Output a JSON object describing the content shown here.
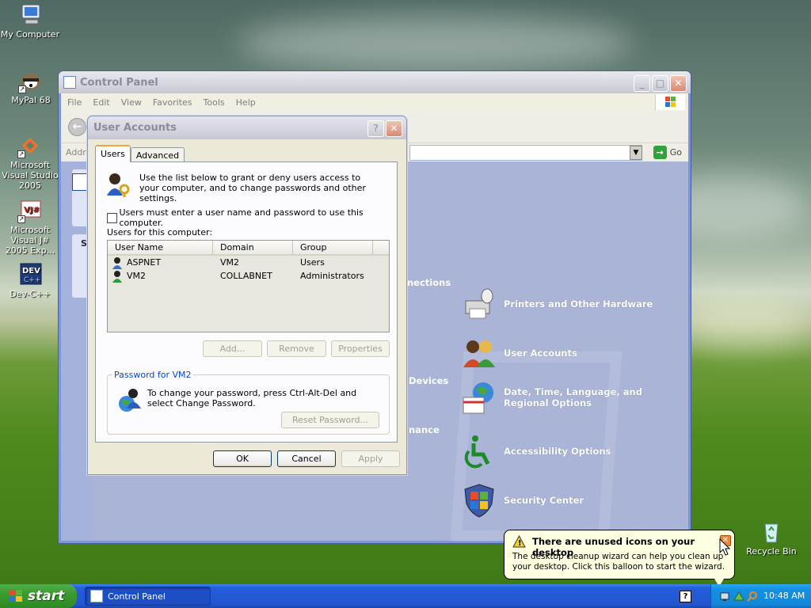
{
  "desktop": {
    "icons": [
      {
        "label": "My Computer"
      },
      {
        "label": "MyPal 68"
      },
      {
        "label": "Microsoft Visual Studio 2005"
      },
      {
        "label": "Microsoft Visual J# 2005 Exp..."
      },
      {
        "label": "Dev-C++"
      },
      {
        "label": "Recycle Bin"
      }
    ]
  },
  "control_panel": {
    "title": "Control Panel",
    "menu": [
      "File",
      "Edit",
      "View",
      "Favorites",
      "Tools",
      "Help"
    ],
    "address_label": "Addre",
    "go_label": "Go",
    "left_cut_label": "S",
    "cut_labels": [
      "nections",
      "Devices",
      "nance"
    ],
    "categories": [
      {
        "label": "Printers and Other Hardware",
        "icon": "printer-icon"
      },
      {
        "label": "User Accounts",
        "icon": "users-icon"
      },
      {
        "label": "Date, Time, Language, and Regional Options",
        "icon": "globe-calendar-icon"
      },
      {
        "label": "Accessibility Options",
        "icon": "accessibility-icon"
      },
      {
        "label": "Security Center",
        "icon": "shield-icon"
      }
    ]
  },
  "user_accounts": {
    "title": "User Accounts",
    "help_button": "?",
    "tabs": [
      "Users",
      "Advanced"
    ],
    "intro": "Use the list below to grant or deny users access to your computer, and to change passwords and other settings.",
    "checkbox_label": "Users must enter a user name and password to use this computer.",
    "checkbox_checked": false,
    "list_label": "Users for this computer:",
    "columns": [
      "User Name",
      "Domain",
      "Group"
    ],
    "users": [
      {
        "name": "ASPNET",
        "domain": "VM2",
        "group": "Users"
      },
      {
        "name": "VM2",
        "domain": "COLLABNET",
        "group": "Administrators"
      }
    ],
    "buttons": {
      "add": "Add...",
      "remove": "Remove",
      "properties": "Properties"
    },
    "password_group": "Password for VM2",
    "password_text": "To change your password, press Ctrl-Alt-Del and select Change Password.",
    "reset_password": "Reset Password...",
    "ok": "OK",
    "cancel": "Cancel",
    "apply": "Apply"
  },
  "balloon": {
    "title": "There are unused icons on your desktop",
    "text": "The desktop cleanup wizard can help you clean up your desktop. Click this balloon to start the wizard."
  },
  "taskbar": {
    "start": "start",
    "tasks": [
      "Control Panel"
    ],
    "clock": "10:48 AM",
    "help_icon": "?"
  },
  "colors": {
    "taskbar": "#245edb",
    "start": "#3c9a2f",
    "control_panel_bg": "#a9b4d6",
    "dialog_bg": "#ece9d8"
  }
}
